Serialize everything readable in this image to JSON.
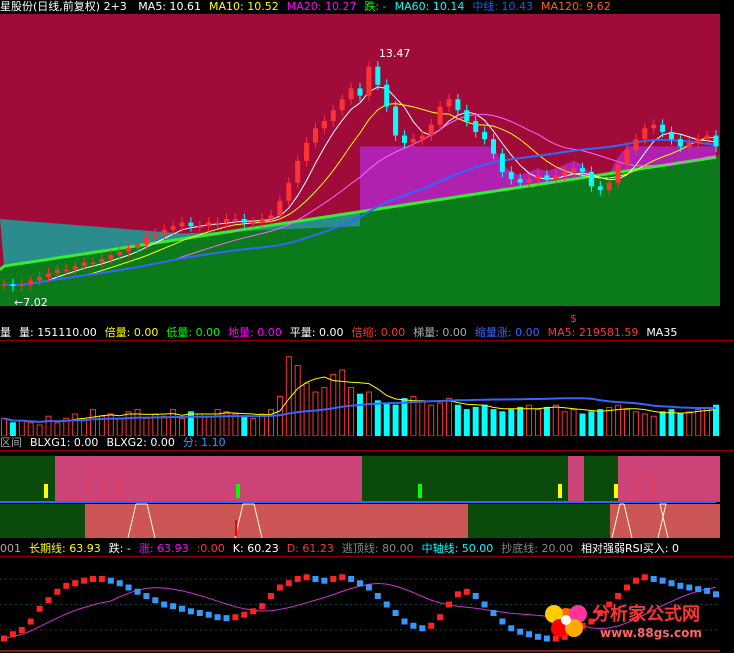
{
  "panel1": {
    "title": "星股份(日线,前复权) 2+3",
    "items": [
      {
        "label": "MA5: 10.61",
        "color": "#ffffff"
      },
      {
        "label": "MA10: 10.52",
        "color": "#ffff00"
      },
      {
        "label": "MA20: 10.27",
        "color": "#ff00ff"
      },
      {
        "label": "跌: -",
        "color": "#00ff00"
      },
      {
        "label": "MA60: 10.14",
        "color": "#00ffff"
      },
      {
        "label": "中线: 10.43",
        "color": "#0066ff"
      },
      {
        "label": "MA120: 9.62",
        "color": "#ff6600"
      }
    ],
    "high_label": "13.47",
    "low_label": "←7.02",
    "marker": "$"
  },
  "panel2": {
    "items": [
      {
        "label": "量",
        "color": "#ffffff"
      },
      {
        "label": "量: 151110.00",
        "color": "#ffffff"
      },
      {
        "label": "倍量: 0.00",
        "color": "#ffff00"
      },
      {
        "label": "低量: 0.00",
        "color": "#00ff00"
      },
      {
        "label": "地量: 0.00",
        "color": "#ff00ff"
      },
      {
        "label": "平量: 0.00",
        "color": "#ffffff"
      },
      {
        "label": "倍缩: 0.00",
        "color": "#ff3333"
      },
      {
        "label": "梯量: 0.00",
        "color": "#aaaaaa"
      },
      {
        "label": "缩量涨: 0.00",
        "color": "#3366ff"
      },
      {
        "label": "MA5: 219581.59",
        "color": "#ff3333"
      },
      {
        "label": "MA35",
        "color": "#ffffff"
      }
    ]
  },
  "panel3": {
    "items": [
      {
        "label": "区间",
        "color": "#aaaaaa"
      },
      {
        "label": "BLXG1: 0.00",
        "color": "#ffffff"
      },
      {
        "label": "BLXG2: 0.00",
        "color": "#ffffff"
      },
      {
        "label": "分: 1.10",
        "color": "#3399ff"
      }
    ]
  },
  "panel4": {
    "items": [
      {
        "label": "001",
        "color": "#aaaaaa"
      },
      {
        "label": "长期线: 63.93",
        "color": "#ffff00"
      },
      {
        "label": "跌: -",
        "color": "#ffffff"
      },
      {
        "label": "涨: 63.93",
        "color": "#ff00ff"
      },
      {
        "label": ":0.00",
        "color": "#ff3333"
      },
      {
        "label": "K: 60.23",
        "color": "#ffffff"
      },
      {
        "label": "D: 61.23",
        "color": "#ff3333"
      },
      {
        "label": "逃顶线: 80.00",
        "color": "#888888"
      },
      {
        "label": "中轴线: 50.00",
        "color": "#00ffff"
      },
      {
        "label": "抄底线: 20.00",
        "color": "#888888"
      },
      {
        "label": "相对强弱RSI买入: 0",
        "color": "#ffffff"
      }
    ],
    "watermark_title": "分析家公式网",
    "watermark_url": "www.88gs.com"
  },
  "colors": {
    "up_candle": "#ffff00",
    "down_candle": "#00ffff",
    "crimson": "#a00b3a",
    "magenta_band": "#b021b0",
    "teal_band": "#2a8c8c",
    "green_band": "#0a7a1a",
    "green_line": "#33ee33"
  },
  "chart_data": [
    {
      "type": "candlestick",
      "title": "星股份(日线,前复权)",
      "ylim": [
        6.5,
        14
      ],
      "annotations": [
        "13.47",
        "7.02"
      ],
      "series": [
        {
          "name": "close",
          "values": [
            7.1,
            7.05,
            7.1,
            7.2,
            7.3,
            7.4,
            7.5,
            7.5,
            7.6,
            7.7,
            7.7,
            7.8,
            7.9,
            8.0,
            8.1,
            8.2,
            8.4,
            8.5,
            8.6,
            8.7,
            8.8,
            8.7,
            8.7,
            8.8,
            8.8,
            8.9,
            8.9,
            8.8,
            8.8,
            8.9,
            9.0,
            9.4,
            9.9,
            10.5,
            11.0,
            11.4,
            11.6,
            11.9,
            12.2,
            12.5,
            12.3,
            13.1,
            12.6,
            12.0,
            11.2,
            11.0,
            11.1,
            11.2,
            11.5,
            12.0,
            12.2,
            11.9,
            11.6,
            11.3,
            11.1,
            10.7,
            10.2,
            10.0,
            9.9,
            10.0,
            10.1,
            10.0,
            10.1,
            10.2,
            10.3,
            10.2,
            9.8,
            9.7,
            9.9,
            10.4,
            10.8,
            11.1,
            11.4,
            11.5,
            11.3,
            11.1,
            10.9,
            11.0,
            11.1,
            11.2,
            10.9
          ]
        }
      ]
    },
    {
      "type": "bar",
      "title": "量",
      "series": [
        {
          "name": "量",
          "values": [
            40,
            30,
            35,
            30,
            25,
            45,
            30,
            40,
            50,
            35,
            60,
            45,
            50,
            40,
            55,
            60,
            40,
            50,
            45,
            60,
            40,
            55,
            50,
            45,
            60,
            55,
            50,
            45,
            40,
            50,
            60,
            90,
            180,
            160,
            120,
            100,
            110,
            140,
            150,
            110,
            95,
            100,
            80,
            75,
            70,
            85,
            90,
            80,
            70,
            75,
            85,
            70,
            60,
            65,
            70,
            60,
            55,
            60,
            65,
            70,
            60,
            65,
            70,
            55,
            60,
            50,
            55,
            60,
            65,
            70,
            60,
            55,
            50,
            45,
            55,
            60,
            50,
            55,
            60,
            65,
            70
          ]
        }
      ]
    },
    {
      "type": "line",
      "title": "",
      "ylim": [
        0,
        100
      ],
      "series": [
        {
          "name": "K",
          "values": [
            10,
            15,
            20,
            30,
            45,
            55,
            65,
            72,
            75,
            78,
            80,
            80,
            78,
            75,
            70,
            65,
            60,
            55,
            50,
            48,
            45,
            42,
            40,
            38,
            35,
            34,
            35,
            38,
            42,
            48,
            60,
            70,
            75,
            80,
            82,
            80,
            78,
            80,
            82,
            80,
            75,
            70,
            60,
            50,
            40,
            30,
            25,
            22,
            25,
            35,
            50,
            62,
            65,
            60,
            50,
            40,
            30,
            22,
            18,
            15,
            12,
            10,
            10,
            12,
            18,
            25,
            30,
            40,
            50,
            60,
            70,
            78,
            82,
            80,
            78,
            75,
            72,
            70,
            68,
            66,
            62
          ]
        }
      ]
    }
  ]
}
